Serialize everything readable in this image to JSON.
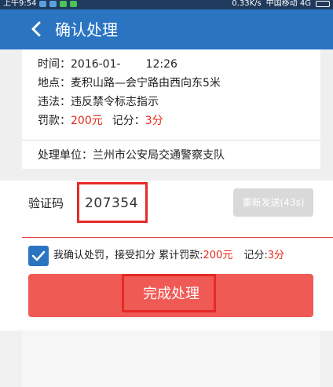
{
  "status_bar": {
    "time": "上午9:54",
    "net_speed": "0.33K/s",
    "carrier": "中国移动 4G"
  },
  "header": {
    "title": "确认处理",
    "back_icon": "chevron-left-icon"
  },
  "violation": {
    "time_label": "时间：",
    "time_value": "2016-01-",
    "time_clock": "12:26",
    "location_label": "地点：",
    "location_value": "麦积山路—会宁路由西向东5米",
    "violation_label": "违法：",
    "violation_value": "违反禁令标志指示",
    "fine_label": "罚款：",
    "fine_value": "200元",
    "points_label": "记分：",
    "points_value": "3分",
    "office_label": "处理单位：",
    "office_value": "兰州市公安局交通警察支队"
  },
  "verify": {
    "label": "验证码",
    "code": "207354",
    "resend_label": "重新发送(43s)"
  },
  "confirm": {
    "checked": true,
    "text": "我确认处罚，接受扣分 累计罚款:",
    "fine": "200元",
    "points_label": "记分:",
    "points": "3分"
  },
  "actions": {
    "finish_label": "完成处理"
  },
  "colors": {
    "app_bar": "#2a74c2",
    "accent_red": "#e8291c",
    "button_red": "#ef5a55",
    "highlight_border": "#e52a27"
  }
}
